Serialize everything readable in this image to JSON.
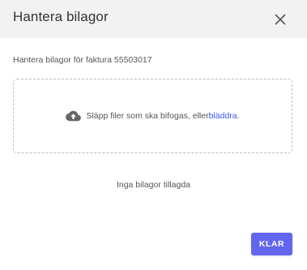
{
  "dialog": {
    "title": "Hantera bilagor",
    "close_icon": "close-icon"
  },
  "subtitle": "Hantera bilagor för faktura 55503017",
  "dropzone": {
    "icon": "cloud-upload-icon",
    "text_before_link": "Släpp filer som ska bifogas, eller ",
    "link_label": "bläddra",
    "text_after_link": "."
  },
  "attachments": {
    "empty_label": "Inga bilagor tillagda"
  },
  "footer": {
    "done_label": "KLAR"
  },
  "colors": {
    "header_bg": "#f2f2f2",
    "accent": "#6266ef",
    "link": "#3d5afe"
  }
}
